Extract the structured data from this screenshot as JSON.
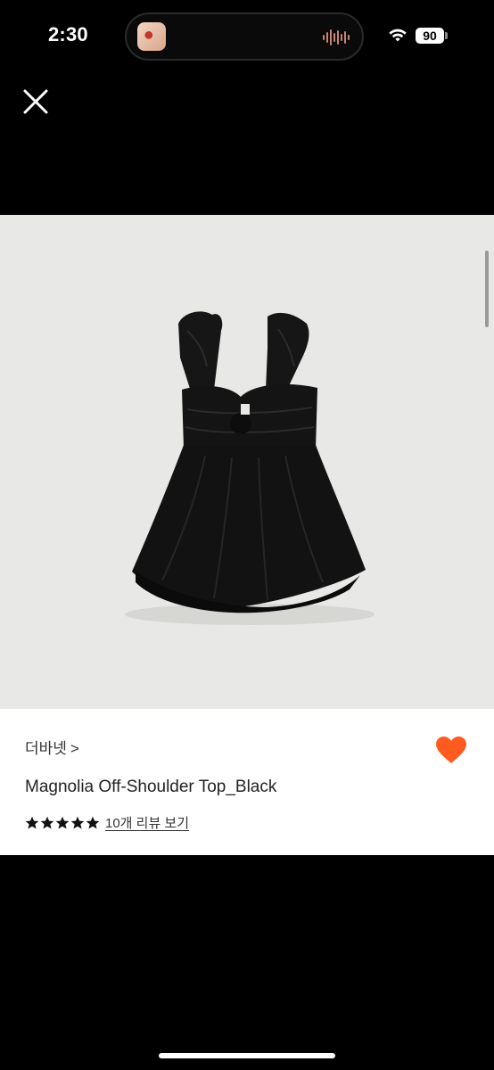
{
  "status_bar": {
    "time": "2:30",
    "battery": "90"
  },
  "product": {
    "brand": "더바넷",
    "brand_chevron": ">",
    "title": "Magnolia Off-Shoulder Top_Black",
    "rating_stars": 5,
    "review_link": "10개 리뷰 보기",
    "favorited": true
  },
  "colors": {
    "heart": "#ff5a1f",
    "background": "#000000",
    "image_bg": "#e8e8e6"
  },
  "icons": [
    "close-icon",
    "heart-icon",
    "star-icon",
    "wifi-icon",
    "battery-icon"
  ]
}
